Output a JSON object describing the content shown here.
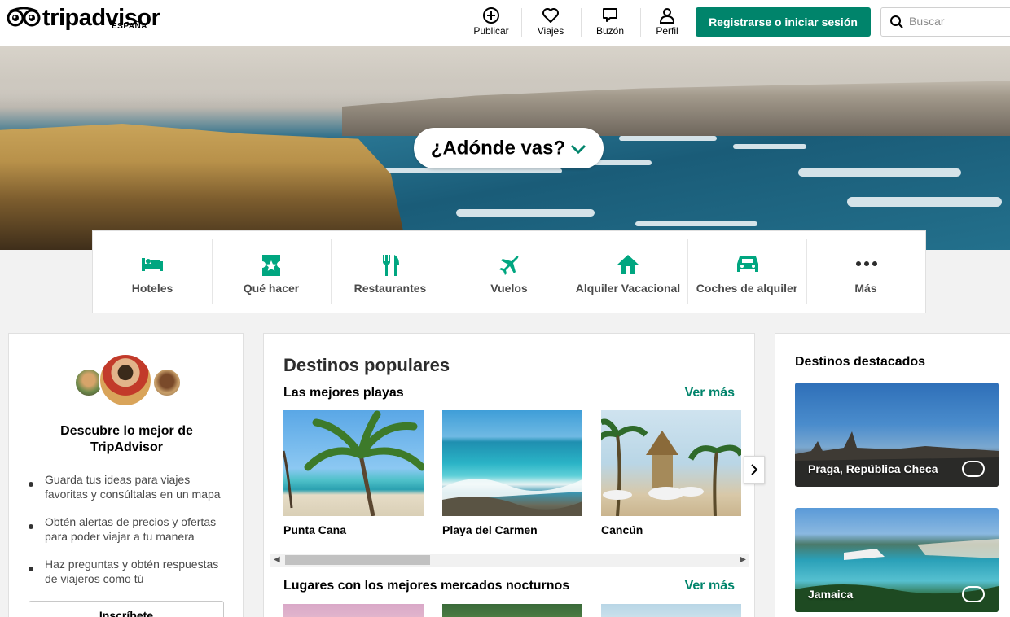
{
  "logo": {
    "wordmark": "tripadvisor",
    "country": "ESPAÑA"
  },
  "nav": [
    {
      "label": "Publicar",
      "icon": "plus-circle-icon"
    },
    {
      "label": "Viajes",
      "icon": "heart-icon"
    },
    {
      "label": "Buzón",
      "icon": "chat-bubble-icon"
    },
    {
      "label": "Perfil",
      "icon": "person-icon"
    }
  ],
  "login_label": "Registrarse o iniciar sesión",
  "search": {
    "placeholder": "Buscar"
  },
  "hero": {
    "where_label": "¿Adónde vas?"
  },
  "categories": [
    {
      "label": "Hoteles",
      "icon": "bed-icon"
    },
    {
      "label": "Qué hacer",
      "icon": "ticket-icon"
    },
    {
      "label": "Restaurantes",
      "icon": "fork-knife-icon"
    },
    {
      "label": "Vuelos",
      "icon": "airplane-icon"
    },
    {
      "label": "Alquiler Vacacional",
      "icon": "house-icon"
    },
    {
      "label": "Coches de alquiler",
      "icon": "car-icon"
    },
    {
      "label": "Más",
      "icon": "more-dots-icon"
    }
  ],
  "left_card": {
    "title": "Descubre lo mejor de TripAdvisor",
    "bullets": [
      "Guarda tus ideas para viajes favoritas y consúltalas en un mapa",
      "Obtén alertas de precios y ofertas para poder viajar a tu manera",
      "Haz preguntas y obtén respuestas de viajeros como tú"
    ],
    "signup_label": "Inscríbete"
  },
  "center_card": {
    "title": "Destinos populares",
    "section1": {
      "title": "Las mejores playas",
      "more": "Ver más"
    },
    "destinations": [
      {
        "name": "Punta Cana"
      },
      {
        "name": "Playa del Carmen"
      },
      {
        "name": "Cancún"
      }
    ],
    "section2": {
      "title": "Lugares con los mejores mercados nocturnos",
      "more": "Ver más"
    }
  },
  "right_card": {
    "title": "Destinos destacados",
    "featured": [
      {
        "name": "Praga, República Checa"
      },
      {
        "name": "Jamaica"
      }
    ]
  },
  "colors": {
    "brand_green": "#00846b",
    "text_gray": "#4a4a4a"
  }
}
